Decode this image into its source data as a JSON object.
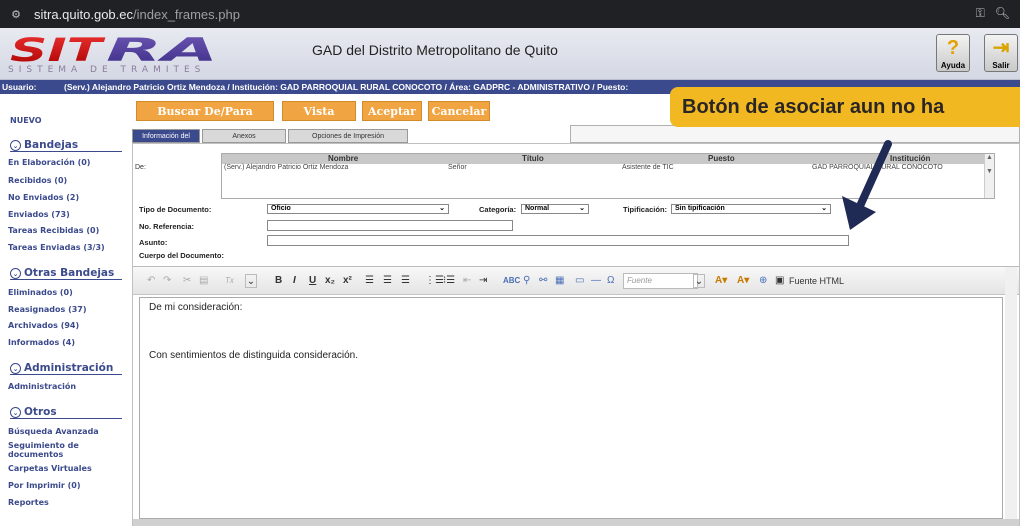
{
  "browser": {
    "url_host": "sitra.quito.gob.ec",
    "url_path": "/index_frames.php"
  },
  "header": {
    "logo_text": "SITRA",
    "logo_sub": "SISTEMA DE TRAMITES",
    "title": "GAD del Distrito Metropolitano de Quito",
    "help_label": "Ayuda",
    "exit_label": "Salir"
  },
  "user_bar": {
    "label": "Usuario:",
    "value": "(Serv.) Alejandro Patricio Ortiz Mendoza / Institución: GAD PARROQUIAL RURAL CONOCOTO / Área: GADPRC - ADMINISTRATIVO / Puesto:"
  },
  "sidebar": {
    "nuevo": "NUEVO",
    "bandejas_title": "Bandejas",
    "bandejas": [
      "En Elaboración (0)",
      "Recibidos (0)",
      "No Enviados (2)",
      "Enviados (73)",
      "Tareas Recibidas (0)",
      "Tareas Enviadas (3/3)"
    ],
    "otras_title": "Otras Bandejas",
    "otras": [
      "Eliminados (0)",
      "Reasignados (37)",
      "Archivados (94)",
      "Informados (4)"
    ],
    "admin_title": "Administración",
    "admin": [
      "Administración"
    ],
    "otros_title": "Otros",
    "otros": [
      "Búsqueda Avanzada",
      "Seguimiento de documentos",
      "Carpetas Virtuales",
      "Por Imprimir (0)",
      "Reportes"
    ]
  },
  "actions": {
    "buscar": "Buscar De/Para",
    "vista_previa": "Vista Previa",
    "aceptar": "Aceptar",
    "cancelar": "Cancelar"
  },
  "banner": "Botón de asociar aun no ha",
  "tabs": [
    "Información del Docu",
    "Anexos",
    "Opciones de Impresión"
  ],
  "de_table": {
    "label": "De:",
    "headers": [
      "Nombre",
      "Título",
      "Puesto",
      "Institución"
    ],
    "row": {
      "nombre": "(Serv.) Alejandro Patricio Ortiz Mendoza",
      "titulo": "Señor",
      "puesto": "Asistente de TIC",
      "institucion": "GAD PARROQUIAL RURAL CONOCOTO"
    }
  },
  "form": {
    "tipo_label": "Tipo de Documento:",
    "tipo_value": "Oficio",
    "categoria_label": "Categoría:",
    "categoria_value": "Normal",
    "tipificacion_label": "Tipificación:",
    "tipificacion_value": "Sin tipificación",
    "referencia_label": "No. Referencia:",
    "asunto_label": "Asunto:",
    "cuerpo_label": "Cuerpo del Documento:"
  },
  "editor": {
    "font_placeholder": "Fuente",
    "html_label": "Fuente HTML",
    "line1": "De mi consideración:",
    "line2": "Con sentimientos de distinguida consideración."
  },
  "colors": {
    "nav": "#3b4a8c",
    "action": "#f0a542",
    "banner": "#f2b822"
  }
}
